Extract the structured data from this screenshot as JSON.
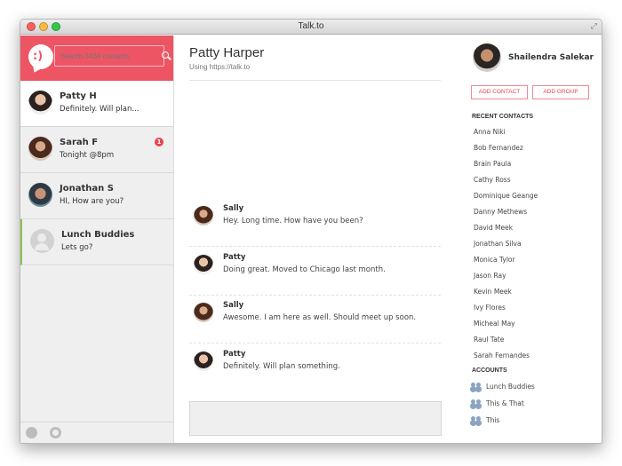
{
  "window": {
    "title": "Talk.to"
  },
  "sidebar": {
    "search_placeholder": "Search 3434 contacts",
    "conversations": [
      {
        "name": "Patty H",
        "preview": "Definitely. Will plan...",
        "active": true
      },
      {
        "name": "Sarah F",
        "preview": "Tonight @8pm",
        "unread": "1"
      },
      {
        "name": "Jonathan S",
        "preview": "HI, How are you?"
      },
      {
        "name": "Lunch Buddies",
        "preview": "Lets go?"
      }
    ]
  },
  "chat": {
    "title": "Patty Harper",
    "subtitle": "Using https://talk.to",
    "messages": [
      {
        "sender": "Sally",
        "text": "Hey. Long time. How have you been?"
      },
      {
        "sender": "Patty",
        "text": "Doing great. Moved to Chicago last month."
      },
      {
        "sender": "Sally",
        "text": "Awesome. I am here as well. Should meet up soon."
      },
      {
        "sender": "Patty",
        "text": "Definitely. Will plan something."
      }
    ]
  },
  "profile": {
    "name": "Shailendra Salekar",
    "add_contact": "ADD CONTACT",
    "add_group": "ADD GROUP"
  },
  "recent_contacts": {
    "heading": "RECENT CONTACTS",
    "items": [
      "Anna Niki",
      "Bob Fernandez",
      "Brain Paula",
      "Cathy Ross",
      "Dominique Geange",
      "Danny Methews",
      "David Meek",
      "Jonathan Silva",
      "Monica Tylor",
      "Jason Ray",
      "Kevin Meek",
      "Ivy Flores",
      "Micheal May",
      "Raul Tate",
      "Sarah Fernandes"
    ]
  },
  "accounts": {
    "heading": "ACCOUNTS",
    "items": [
      "Lunch Buddies",
      "This & That",
      "This"
    ]
  },
  "colors": {
    "accent": "#ed5565",
    "badge": "#e9434f",
    "online_indicator": "#8cc152"
  }
}
